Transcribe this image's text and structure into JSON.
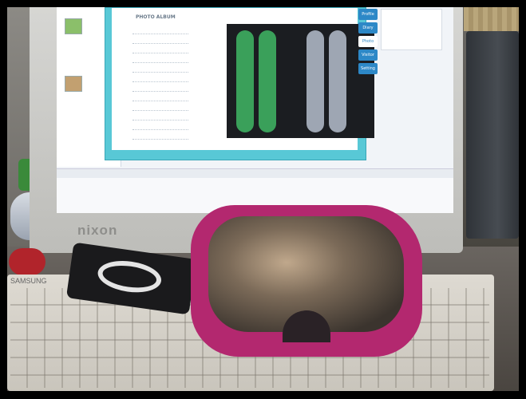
{
  "monitor": {
    "brand": "nixon"
  },
  "screen": {
    "album_title": "PHOTO ALBUM",
    "nav_tabs": [
      "Profile",
      "Diary",
      "Photo",
      "Visitor",
      "Setting"
    ]
  },
  "keyboard": {
    "brand": "SAMSUNG"
  },
  "colors": {
    "goggle_frame": "#b3286f",
    "screen_accent": "#58c8d6",
    "nav_tab": "#2d88c7"
  }
}
